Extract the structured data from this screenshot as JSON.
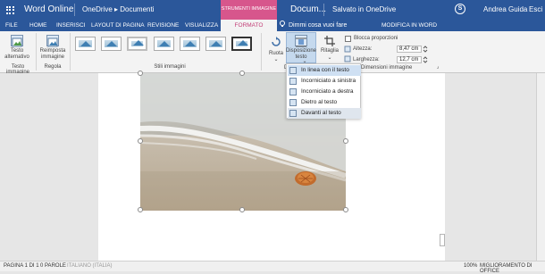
{
  "app": {
    "name": "Word Online",
    "breadcrumb": "OneDrive ▸ Documenti",
    "context_group": "STRUMENTI IMMAGINE",
    "document_title": "Docum...",
    "save_status": "Salvato in OneDrive",
    "skype_label": "S",
    "user_name": "Andrea Guida",
    "signout": "Esci"
  },
  "tabs": [
    {
      "label": "FILE"
    },
    {
      "label": "HOME"
    },
    {
      "label": "INSERISCI"
    },
    {
      "label": "LAYOUT DI PAGINA"
    },
    {
      "label": "REVISIONE"
    },
    {
      "label": "VISUALIZZA"
    },
    {
      "label": "FORMATO",
      "active": true
    }
  ],
  "tell_me": "Dimmi cosa vuoi fare",
  "modify_word": "MODIFICA IN WORD",
  "ribbon": {
    "alt_text_btn": "Testo\nalternativo",
    "alt_text_group": "Testo immagine",
    "reset_btn": "Reimposta\nimmagine",
    "reset_group": "Regola",
    "styles_group": "Stili immagini",
    "rotate_btn": "Ruota",
    "rotate_caret": "⌄",
    "position_btn": "Disposizione\ntesto",
    "position_caret": "⌄",
    "crop_btn": "Ritaglia",
    "crop_caret": "⌄",
    "lock_ratio": "Blocca proporzioni",
    "height_label": "Altezza:",
    "height_value": "8,47 cm",
    "width_label": "Larghezza:",
    "width_value": "12,7 cm",
    "size_group": "Dimensioni immagine",
    "group_fragment_d": "D",
    "dialog_launcher_glyph": "⌟"
  },
  "wrap_menu": [
    {
      "label": "In linea con il testo",
      "selected": true
    },
    {
      "label": "Incorniciato a sinistra"
    },
    {
      "label": "Incorniciato a destra"
    },
    {
      "label": "Dietro al testo"
    },
    {
      "label": "Davanti al testo",
      "highlighted": true
    }
  ],
  "status": {
    "page": "PAGINA 1 DI 1",
    "words": "0 PAROLE",
    "language": "ITALIANO (ITALIA)",
    "zoom": "100%",
    "improve": "MIGLIORAMENTO DI OFFICE"
  },
  "colors": {
    "word_blue": "#2b579a",
    "picture_tools_pink": "#d7568c",
    "active_tab_text": "#c23e76"
  }
}
